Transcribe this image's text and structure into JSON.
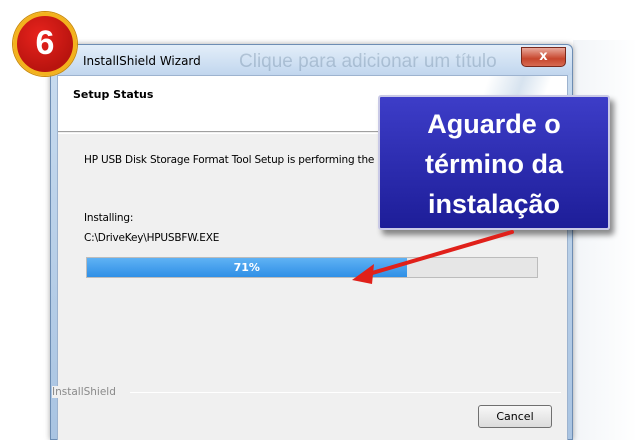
{
  "window": {
    "title": "InstallShield Wizard",
    "faded_background_text": "Clique para adicionar um título",
    "close_label": "x"
  },
  "header": {
    "title": "Setup Status"
  },
  "body": {
    "description": "HP USB Disk Storage Format Tool Setup is performing the re",
    "installing_label": "Installing:",
    "file_path": "C:\\DriveKey\\HPUSBFW.EXE"
  },
  "progress": {
    "percent": 71,
    "label": "71%"
  },
  "footer": {
    "brand": "InstallShield",
    "cancel_label": "Cancel"
  },
  "step_badge": {
    "number": "6"
  },
  "callout": {
    "line1": "Aguarde o",
    "line2": "término da",
    "line3": "instalação"
  },
  "colors": {
    "callout_bg": "#2a2ab0",
    "badge_red": "#d01a14",
    "badge_ring": "#f3b21e",
    "arrow_red": "#e0201a",
    "progress_fill": "#3a9ae8"
  }
}
